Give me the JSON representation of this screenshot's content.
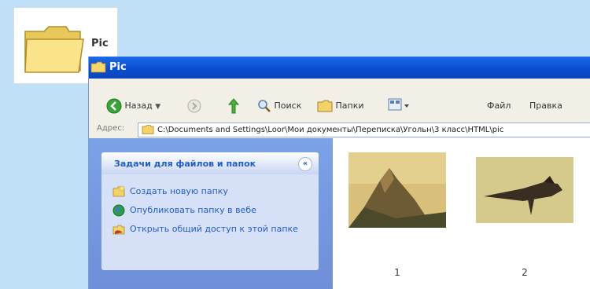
{
  "desktop": {
    "folder_icon": "folder-icon",
    "label": "Pic"
  },
  "window": {
    "title": "Pic",
    "toolbar": {
      "back_label": "Назад",
      "search_label": "Поиск",
      "folders_label": "Папки",
      "file_label": "Файл",
      "edit_label": "Правка"
    },
    "address": {
      "label": "Адрес:",
      "path": "C:\\Documents and Settings\\Loor\\Мои документы\\Переписка\\Угольн\\3 класс\\HTML\\pic"
    },
    "task_panel": {
      "title": "Задачи для файлов и папок",
      "collapse_icon": "collapse-icon",
      "items": [
        {
          "icon": "new-folder-icon",
          "label": "Создать новую папку"
        },
        {
          "icon": "globe-icon",
          "label": "Опубликовать папку в вебе"
        },
        {
          "icon": "share-icon",
          "label": "Открыть общий доступ к этой папке"
        }
      ]
    },
    "files": [
      {
        "name": "1",
        "thumb": "mountain-image"
      },
      {
        "name": "2",
        "thumb": "bird-image"
      }
    ]
  },
  "colors": {
    "desktop_bg": "#bfe0f6",
    "titlebar": "#0a4ed0",
    "taskpane": "#7ba2e7",
    "link": "#215dc6"
  }
}
